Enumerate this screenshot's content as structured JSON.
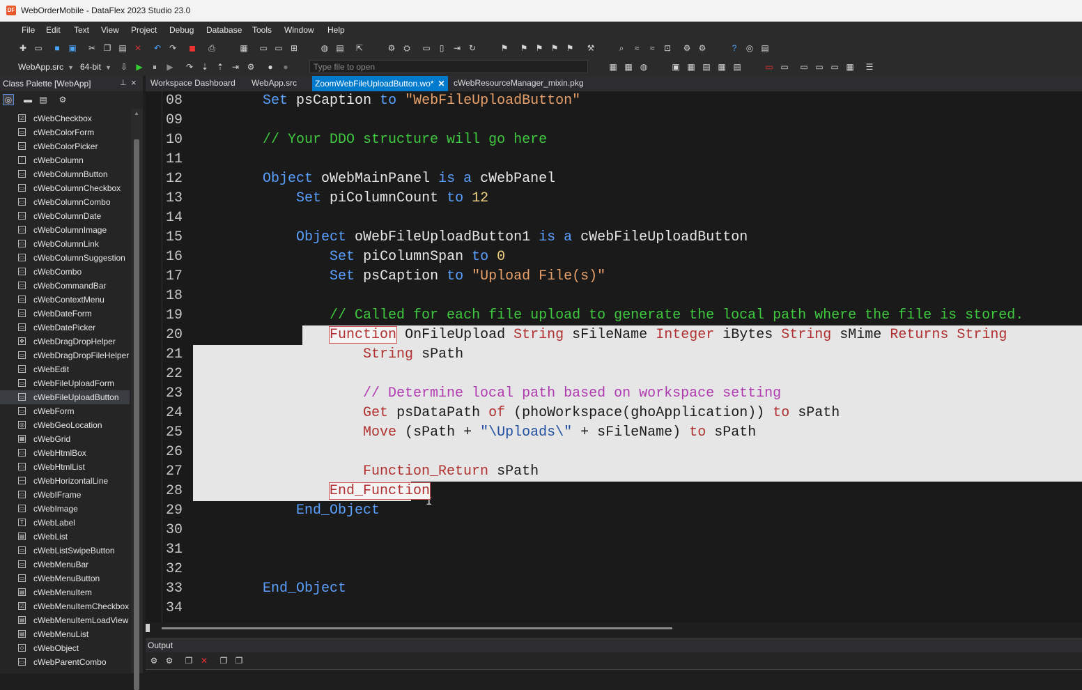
{
  "window": {
    "title": "WebOrderMobile - DataFlex 2023 Studio 23.0",
    "logo_text": "DF"
  },
  "menu": [
    "File",
    "Edit",
    "Text",
    "View",
    "Project",
    "Debug",
    "Database",
    "Tools",
    "Window",
    "Help"
  ],
  "toolbar": {
    "project_combo": "WebApp.src",
    "platform_combo": "64-bit",
    "file_open_placeholder": "Type file to open"
  },
  "palette": {
    "title": "Class Palette [WebApp]",
    "selected": "cWebFileUploadButton",
    "items": [
      "cWebCheckbox",
      "cWebColorForm",
      "cWebColorPicker",
      "cWebColumn",
      "cWebColumnButton",
      "cWebColumnCheckbox",
      "cWebColumnCombo",
      "cWebColumnDate",
      "cWebColumnImage",
      "cWebColumnLink",
      "cWebColumnSuggestion",
      "cWebCombo",
      "cWebCommandBar",
      "cWebContextMenu",
      "cWebDateForm",
      "cWebDatePicker",
      "cWebDragDropHelper",
      "cWebDragDropFileHelper",
      "cWebEdit",
      "cWebFileUploadForm",
      "cWebFileUploadButton",
      "cWebForm",
      "cWebGeoLocation",
      "cWebGrid",
      "cWebHtmlBox",
      "cWebHtmlList",
      "cWebHorizontalLine",
      "cWebIFrame",
      "cWebImage",
      "cWebLabel",
      "cWebList",
      "cWebListSwipeButton",
      "cWebMenuBar",
      "cWebMenuButton",
      "cWebMenuItem",
      "cWebMenuItemCheckbox",
      "cWebMenuItemLoadView",
      "cWebMenuList",
      "cWebObject",
      "cWebParentCombo"
    ]
  },
  "tabs": [
    {
      "label": "Workspace Dashboard",
      "active": false
    },
    {
      "label": "WebApp.src",
      "active": false
    },
    {
      "label": "ZoomWebFileUploadButton.wo*",
      "active": true
    },
    {
      "label": "cWebResourceManager_mixin.pkg",
      "active": false
    }
  ],
  "editor": {
    "lines": [
      {
        "n": "08",
        "t": "    Set psCaption to \"WebFileUploadButton\""
      },
      {
        "n": "09",
        "t": ""
      },
      {
        "n": "10",
        "t": "    // Your DDO structure will go here"
      },
      {
        "n": "11",
        "t": ""
      },
      {
        "n": "12",
        "t": "    Object oWebMainPanel is a cWebPanel"
      },
      {
        "n": "13",
        "t": "        Set piColumnCount to 12"
      },
      {
        "n": "14",
        "t": ""
      },
      {
        "n": "15",
        "t": "        Object oWebFileUploadButton1 is a cWebFileUploadButton"
      },
      {
        "n": "16",
        "t": "            Set piColumnSpan to 0"
      },
      {
        "n": "17",
        "t": "            Set psCaption to \"Upload File(s)\""
      },
      {
        "n": "18",
        "t": ""
      },
      {
        "n": "19",
        "t": "            // Called for each file upload to generate the local path where the file is stored."
      },
      {
        "n": "20",
        "t": "            Function OnFileUpload String sFileName Integer iBytes String sMime Returns String"
      },
      {
        "n": "21",
        "t": "                String sPath"
      },
      {
        "n": "22",
        "t": ""
      },
      {
        "n": "23",
        "t": "                // Determine local path based on workspace setting"
      },
      {
        "n": "24",
        "t": "                Get psDataPath of (phoWorkspace(ghoApplication)) to sPath"
      },
      {
        "n": "25",
        "t": "                Move (sPath + \"\\Uploads\\\" + sFileName) to sPath"
      },
      {
        "n": "26",
        "t": ""
      },
      {
        "n": "27",
        "t": "                Function_Return sPath"
      },
      {
        "n": "28",
        "t": "            End_Function"
      },
      {
        "n": "29",
        "t": "        End_Object"
      },
      {
        "n": "30",
        "t": ""
      },
      {
        "n": "31",
        "t": ""
      },
      {
        "n": "32",
        "t": ""
      },
      {
        "n": "33",
        "t": "    End_Object"
      },
      {
        "n": "34",
        "t": ""
      }
    ],
    "selected_lines": [
      "20",
      "21",
      "22",
      "23",
      "24",
      "25",
      "26",
      "27",
      "28"
    ]
  },
  "output": {
    "title": "Output"
  }
}
